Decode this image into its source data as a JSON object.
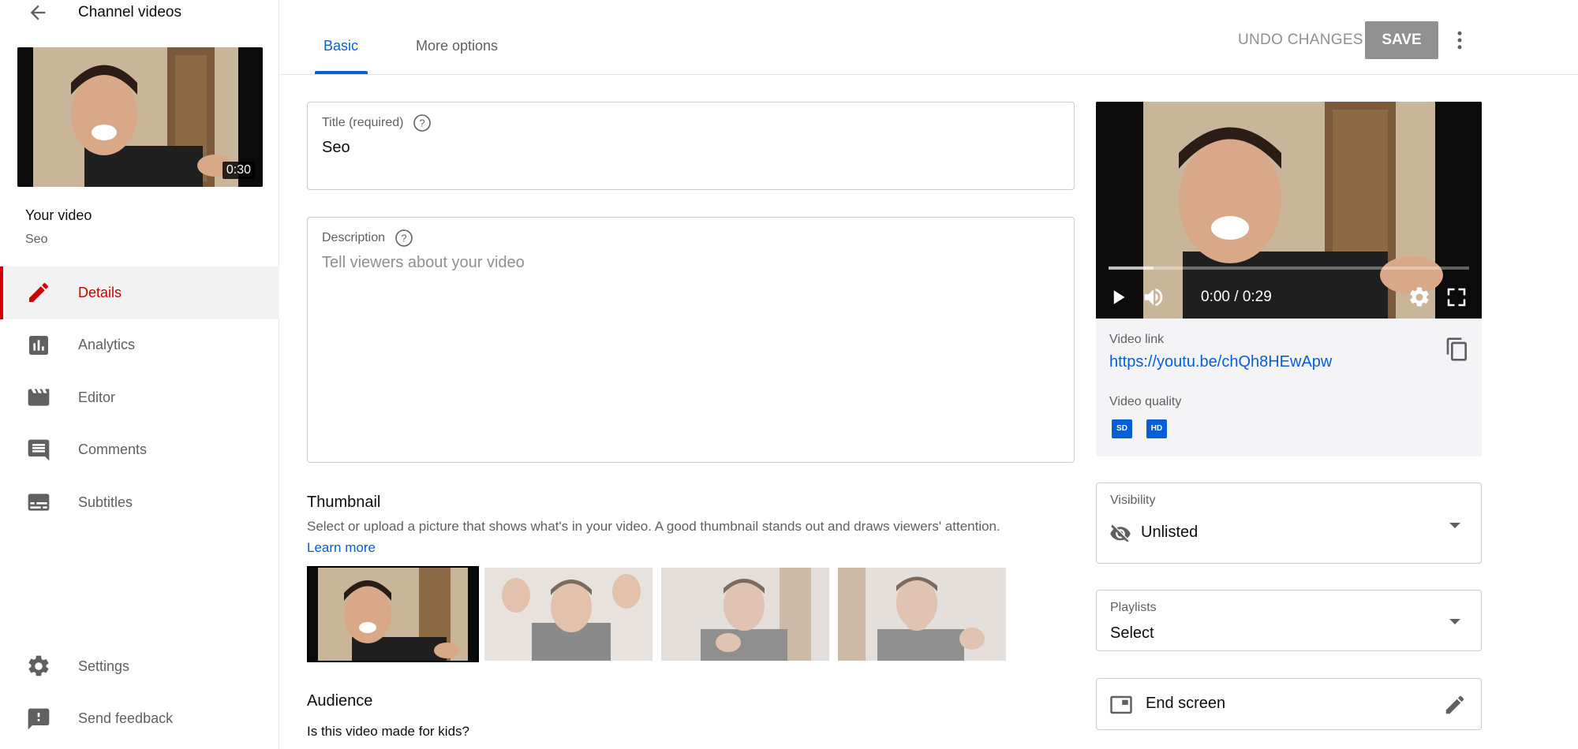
{
  "sidebar": {
    "back_icon": "arrow-left-icon",
    "channel_title": "Channel videos",
    "thumbnail_duration": "0:30",
    "your_video_label": "Your video",
    "video_name": "Seo",
    "nav_items": [
      {
        "label": "Details",
        "icon": "pencil-icon",
        "active": true
      },
      {
        "label": "Analytics",
        "icon": "analytics-icon",
        "active": false
      },
      {
        "label": "Editor",
        "icon": "clapperboard-icon",
        "active": false
      },
      {
        "label": "Comments",
        "icon": "comment-icon",
        "active": false
      },
      {
        "label": "Subtitles",
        "icon": "subtitles-icon",
        "active": false
      }
    ],
    "bottom_items": [
      {
        "label": "Settings",
        "icon": "gear-icon"
      },
      {
        "label": "Send feedback",
        "icon": "feedback-icon"
      }
    ]
  },
  "header": {
    "tabs": [
      {
        "label": "Basic",
        "active": true
      },
      {
        "label": "More options",
        "active": false
      }
    ],
    "undo_label": "UNDO CHANGES",
    "save_label": "SAVE",
    "more_icon": "more-vert-icon"
  },
  "form": {
    "title_label": "Title (required)",
    "title_value": "Seo",
    "description_label": "Description",
    "description_placeholder": "Tell viewers about your video",
    "thumbnail_heading": "Thumbnail",
    "thumbnail_description": "Select or upload a picture that shows what's in your video. A good thumbnail stands out and draws viewers' attention.",
    "learn_more": "Learn more",
    "audience_heading": "Audience",
    "kids_question": "Is this video made for kids?"
  },
  "preview": {
    "time": "0:00 / 0:29",
    "progress_fraction": 0,
    "buffered_fraction": 0.125,
    "video_link_label": "Video link",
    "video_link": "https://youtu.be/chQh8HEwApw",
    "video_quality_label": "Video quality",
    "quality_badges": [
      "SD",
      "HD"
    ]
  },
  "visibility": {
    "label": "Visibility",
    "value": "Unlisted",
    "icon": "eye-off-icon"
  },
  "playlists": {
    "label": "Playlists",
    "value": "Select"
  },
  "end_screen": {
    "label": "End screen",
    "icon": "end-screen-icon",
    "edit_icon": "pencil-icon"
  },
  "colors": {
    "accent_blue": "#065fd4",
    "active_red": "#cc0000",
    "save_disabled": "#909090"
  }
}
